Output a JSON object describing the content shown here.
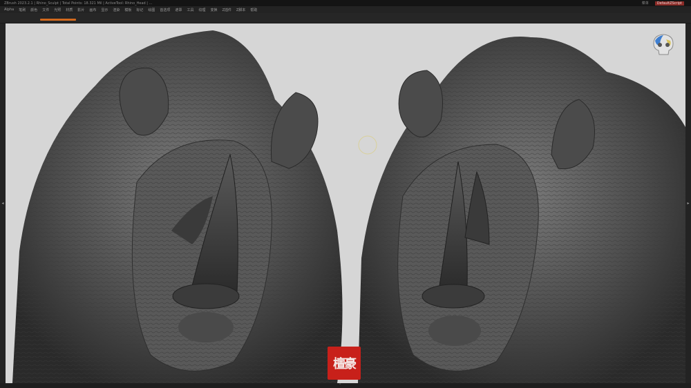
{
  "window": {
    "title": "ZBrush 2023.2.1 | Rhino_Sculpt | Total Points: 18.321 Mil | ActiveTool: Rhino_Head | ... ",
    "right_buttons": [
      "菜单",
      "DefaultZScript"
    ]
  },
  "menu": {
    "items": [
      "Alpha",
      "笔刷",
      "颜色",
      "文件",
      "光照",
      "材质",
      "影片",
      "画布",
      "显示",
      "渲染",
      "模板",
      "标记",
      "绘图",
      "首选项",
      "遮罩",
      "工具",
      "纹理",
      "变换",
      "Z插件",
      "Z脚本",
      "帮助"
    ]
  },
  "tabs": {
    "active_label": ""
  },
  "seal": {
    "text": "檀豪"
  },
  "bottom": {
    "handle": "⌃"
  },
  "colors": {
    "accent": "#d2691e",
    "seal_red": "#c8201a",
    "canvas_bg": "#d6d6d6"
  },
  "icons": {
    "nav_cube": "skull-icon",
    "left_arrow": "chevron-left-icon",
    "right_arrow": "chevron-right-icon"
  }
}
